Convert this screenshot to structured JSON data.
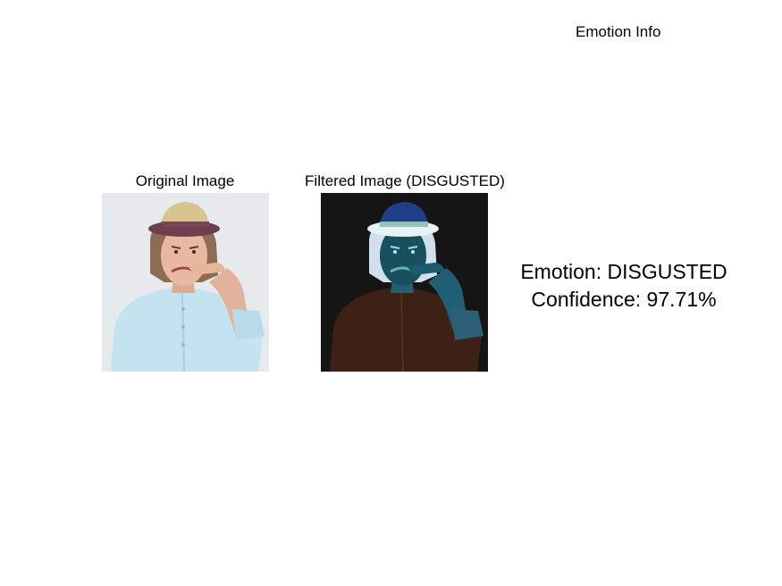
{
  "figure": {
    "info_title": "Emotion Info",
    "original_title": "Original Image",
    "filtered_title": "Filtered Image (DISGUSTED)",
    "emotion_text": "Emotion: DISGUSTED",
    "confidence_text": "Confidence: 97.71%"
  },
  "images": {
    "original": {
      "subject": "woman-with-hat-disgusted-face",
      "palette": {
        "background": "#e6e9ec",
        "shirt": "#bfe2ee",
        "skin": "#e6b59c",
        "hair": "#8a6a52",
        "hat": "#d6c08a",
        "hat_band": "#6b3a4a"
      }
    },
    "filtered": {
      "subject": "woman-with-hat-disgusted-face-inverted",
      "palette": {
        "background": "#141414",
        "shirt": "#3c1f12",
        "skin": "#1f5d6c",
        "hair": "#c9dde8",
        "hat": "#1a3a7a",
        "hat_band": "#8fc3b2"
      }
    }
  }
}
